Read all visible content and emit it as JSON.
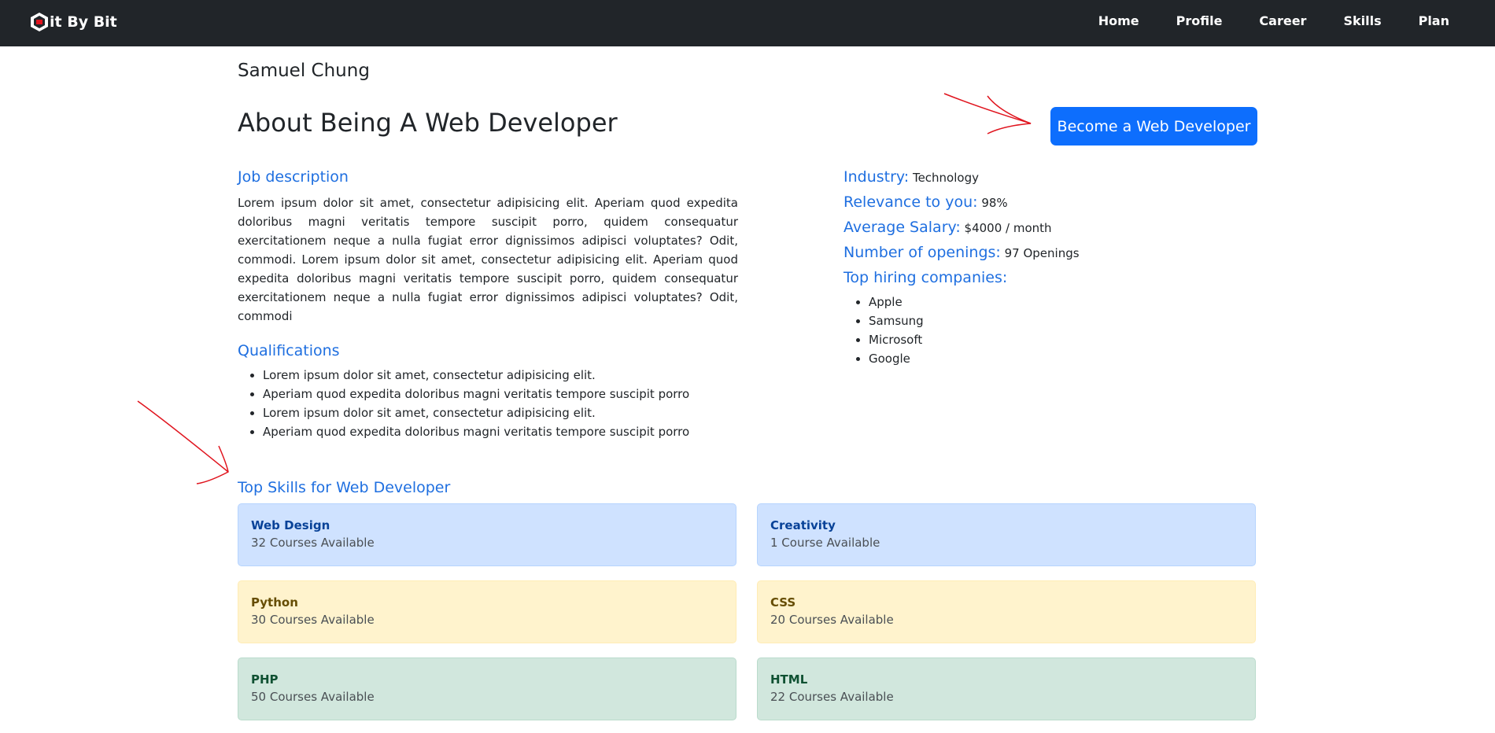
{
  "nav": {
    "brand": "it By Bit",
    "links": [
      "Home",
      "Profile",
      "Career",
      "Skills",
      "Plan"
    ]
  },
  "user": {
    "name": "Samuel Chung"
  },
  "page": {
    "title": "About Being A Web Developer",
    "cta_label": "Become a Web Developer"
  },
  "job": {
    "heading": "Job description",
    "text": "Lorem ipsum dolor sit amet, consectetur adipisicing elit. Aperiam quod expedita doloribus magni veritatis tempore suscipit porro, quidem consequatur exercitationem neque a nulla fugiat error dignissimos adipisci voluptates? Odit, commodi. Lorem ipsum dolor sit amet, consectetur adipisicing elit. Aperiam quod expedita doloribus magni veritatis tempore suscipit porro, quidem consequatur exercitationem neque a nulla fugiat error dignissimos adipisci voluptates? Odit, commodi"
  },
  "qualifications": {
    "heading": "Qualifications",
    "items": [
      "Lorem ipsum dolor sit amet, consectetur adipisicing elit.",
      "Aperiam quod expedita doloribus magni veritatis tempore suscipit porro",
      "Lorem ipsum dolor sit amet, consectetur adipisicing elit.",
      "Aperiam quod expedita doloribus magni veritatis tempore suscipit porro"
    ]
  },
  "info": {
    "industry_label": "Industry:",
    "industry_value": "Technology",
    "relevance_label": "Relevance to you:",
    "relevance_value": "98%",
    "salary_label": "Average Salary:",
    "salary_value": "$4000 / month",
    "openings_label": "Number of openings:",
    "openings_value": "97 Openings",
    "companies_label": "Top hiring companies:",
    "companies": [
      "Apple",
      "Samsung",
      "Microsoft",
      "Google"
    ]
  },
  "skills": {
    "heading": "Top Skills for Web Developer",
    "cards": [
      {
        "name": "Web Design",
        "count": "32 Courses Available",
        "color": "blue"
      },
      {
        "name": "Creativity",
        "count": "1 Course Available",
        "color": "blue"
      },
      {
        "name": "Python",
        "count": "30 Courses Available",
        "color": "yellow"
      },
      {
        "name": "CSS",
        "count": "20 Courses Available",
        "color": "yellow"
      },
      {
        "name": "PHP",
        "count": "50 Courses Available",
        "color": "green"
      },
      {
        "name": "HTML",
        "count": "22 Courses Available",
        "color": "green"
      }
    ]
  },
  "colors": {
    "navbar": "#212529",
    "primary": "#0d6efd",
    "heading_blue": "#1f6fe0",
    "annotation_red": "#e0141e"
  }
}
